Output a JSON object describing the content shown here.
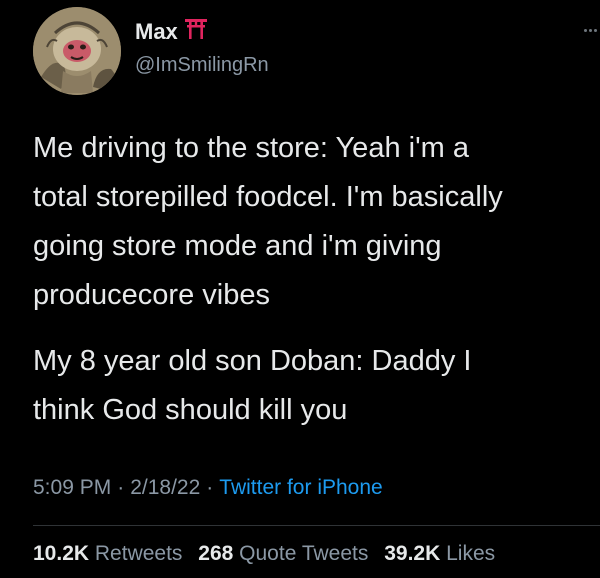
{
  "user": {
    "display_name": "Max",
    "handle": "@ImSmilingRn",
    "emoji": "torii-gate"
  },
  "tweet": {
    "paragraph_1": "Me driving to the store: Yeah i'm a\ntotal storepilled foodcel. I'm basically\ngoing store mode and i'm giving\nproducecore vibes",
    "paragraph_2": "My 8 year old son Doban: Daddy I\nthink God should kill you"
  },
  "meta": {
    "time": "5:09 PM",
    "separator": "·",
    "date": "2/18/22",
    "source": "Twitter for iPhone"
  },
  "stats": {
    "retweets_count": "10.2K",
    "retweets_label": "Retweets",
    "quotes_count": "268",
    "quotes_label": "Quote Tweets",
    "likes_count": "39.2K",
    "likes_label": "Likes"
  },
  "colors": {
    "background": "#000000",
    "text": "#e7e9ea",
    "secondary": "#8b98a5",
    "link": "#1d9bf0",
    "torii": "#e0245e"
  },
  "icons": {
    "avatar": "monkey-avatar",
    "more": "more-icon"
  }
}
